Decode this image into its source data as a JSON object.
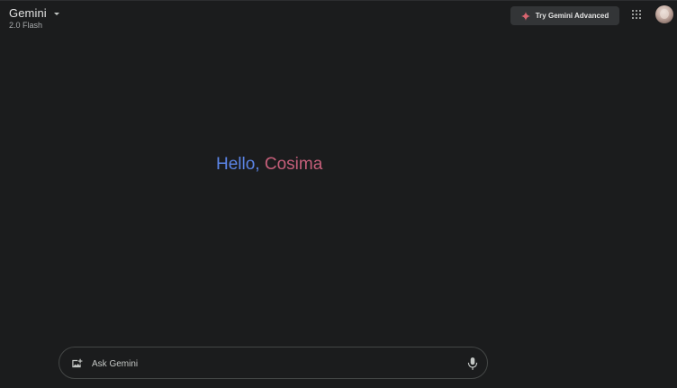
{
  "header": {
    "app_title": "Gemini",
    "model_label": "2.0 Flash",
    "model_dropdown_icon": "caret-down-icon",
    "advanced_button": {
      "label": "Try Gemini Advanced",
      "icon": "spark-icon",
      "icon_color": "#d96570"
    },
    "apps_icon": "apps-grid-icon",
    "avatar_icon": "user-avatar"
  },
  "main": {
    "greeting_hello": "Hello,",
    "greeting_name": " Cosima",
    "greeting_colors": {
      "hello": "#5b84e6",
      "name": "#c65f7a"
    }
  },
  "input": {
    "placeholder": "Ask Gemini",
    "value": "",
    "upload_icon": "add-image-icon",
    "mic_icon": "microphone-icon"
  },
  "theme": {
    "background": "#1b1c1d",
    "surface": "#333537",
    "border": "#444746",
    "text": "#e3e3e3"
  }
}
